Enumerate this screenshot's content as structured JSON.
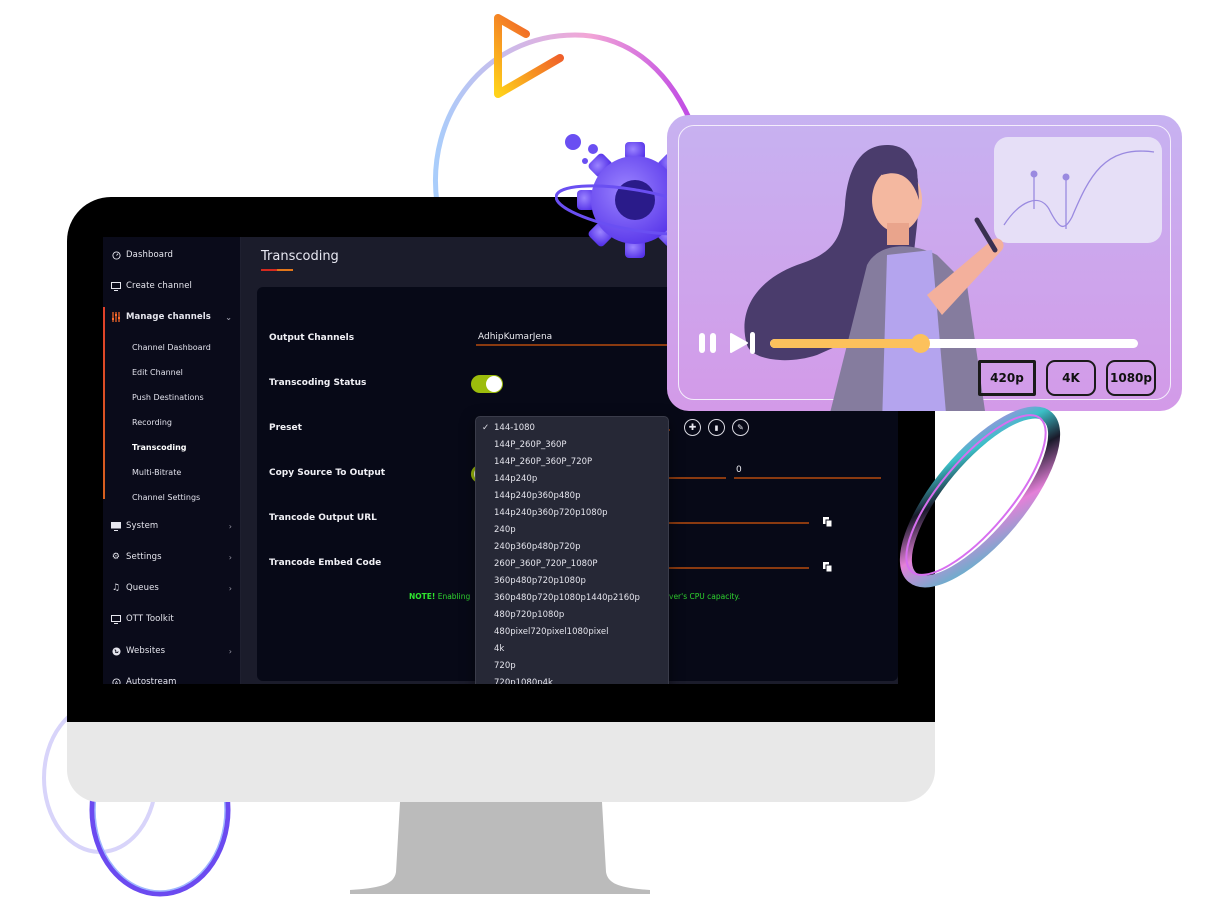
{
  "sidebar": {
    "items": [
      {
        "label": "Dashboard",
        "icon": "gauge-icon"
      },
      {
        "label": "Create channel",
        "icon": "monitor-icon"
      },
      {
        "label": "Manage channels",
        "icon": "sliders-icon",
        "expanded": true
      },
      {
        "label": "System",
        "icon": "desktop-icon"
      },
      {
        "label": "Settings",
        "icon": "gear-icon"
      },
      {
        "label": "Queues",
        "icon": "music-queue-icon"
      },
      {
        "label": "OTT Toolkit",
        "icon": "tv-icon"
      },
      {
        "label": "Websites",
        "icon": "globe-icon"
      },
      {
        "label": "Autostream",
        "icon": "autostream-icon"
      }
    ],
    "subitems": [
      {
        "label": "Channel Dashboard"
      },
      {
        "label": "Edit Channel"
      },
      {
        "label": "Push Destinations"
      },
      {
        "label": "Recording"
      },
      {
        "label": "Transcoding",
        "current": true
      },
      {
        "label": "Multi-Bitrate"
      },
      {
        "label": "Channel Settings"
      }
    ]
  },
  "main": {
    "title": "Transcoding",
    "fields": {
      "output_channels_label": "Output Channels",
      "output_channels_value": "AdhipKumarJena",
      "transcoding_status_label": "Transcoding Status",
      "transcoding_status_on": true,
      "preset_label": "Preset",
      "copy_source_label": "Copy Source To Output",
      "copy_source_value": "0",
      "output_url_label": "Trancode Output URL",
      "embed_code_label": "Trancode Embed Code"
    },
    "note": {
      "prefix": "NOTE!",
      "text_left": "Enabling",
      "text_right": "ver's CPU capacity."
    },
    "preset_dropdown": {
      "selected": "144-1080",
      "options": [
        "144-1080",
        "144P_260P_360P",
        "144P_260P_360P_720P",
        "144p240p",
        "144p240p360p480p",
        "144p240p360p720p1080p",
        "240p",
        "240p360p480p720p",
        "260P_360P_720P_1080P",
        "360p480p720p1080p",
        "360p480p720p1080p1440p2160p",
        "480p720p1080p",
        "480pixel720pixel1080pixel",
        "4k",
        "720p",
        "720p1080p4k"
      ]
    }
  },
  "video_card": {
    "progress": 0.41,
    "quality_options": [
      "420p",
      "4K",
      "1080p"
    ],
    "selected_quality": "420p"
  },
  "colors": {
    "accent_orange": "#e2761a",
    "toggle_green": "#9cbc0c",
    "note_green": "#2fd62f",
    "progress_yellow": "#fcc15c"
  }
}
